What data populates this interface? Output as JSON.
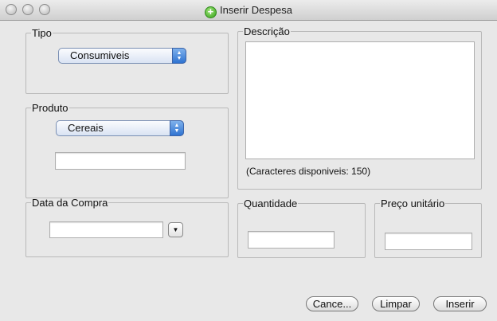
{
  "window": {
    "title": "Inserir Despesa"
  },
  "tipo": {
    "legend": "Tipo",
    "selected": "Consumiveis"
  },
  "produto": {
    "legend": "Produto",
    "selected": "Cereais",
    "field_value": ""
  },
  "descricao": {
    "legend": "Descrição",
    "text": "",
    "counter": "(Caracteres disponiveis: 150)"
  },
  "data_compra": {
    "legend": "Data da Compra",
    "value": ""
  },
  "quantidade": {
    "legend": "Quantidade",
    "value": ""
  },
  "preco": {
    "legend": "Preço unitário",
    "value": ""
  },
  "buttons": {
    "cancel": "Cance...",
    "clear": "Limpar",
    "insert": "Inserir"
  },
  "icons": {
    "title_icon": "add-icon",
    "popup_arrows": "up-down-arrows-icon",
    "date_dropdown": "chevron-down-icon"
  }
}
